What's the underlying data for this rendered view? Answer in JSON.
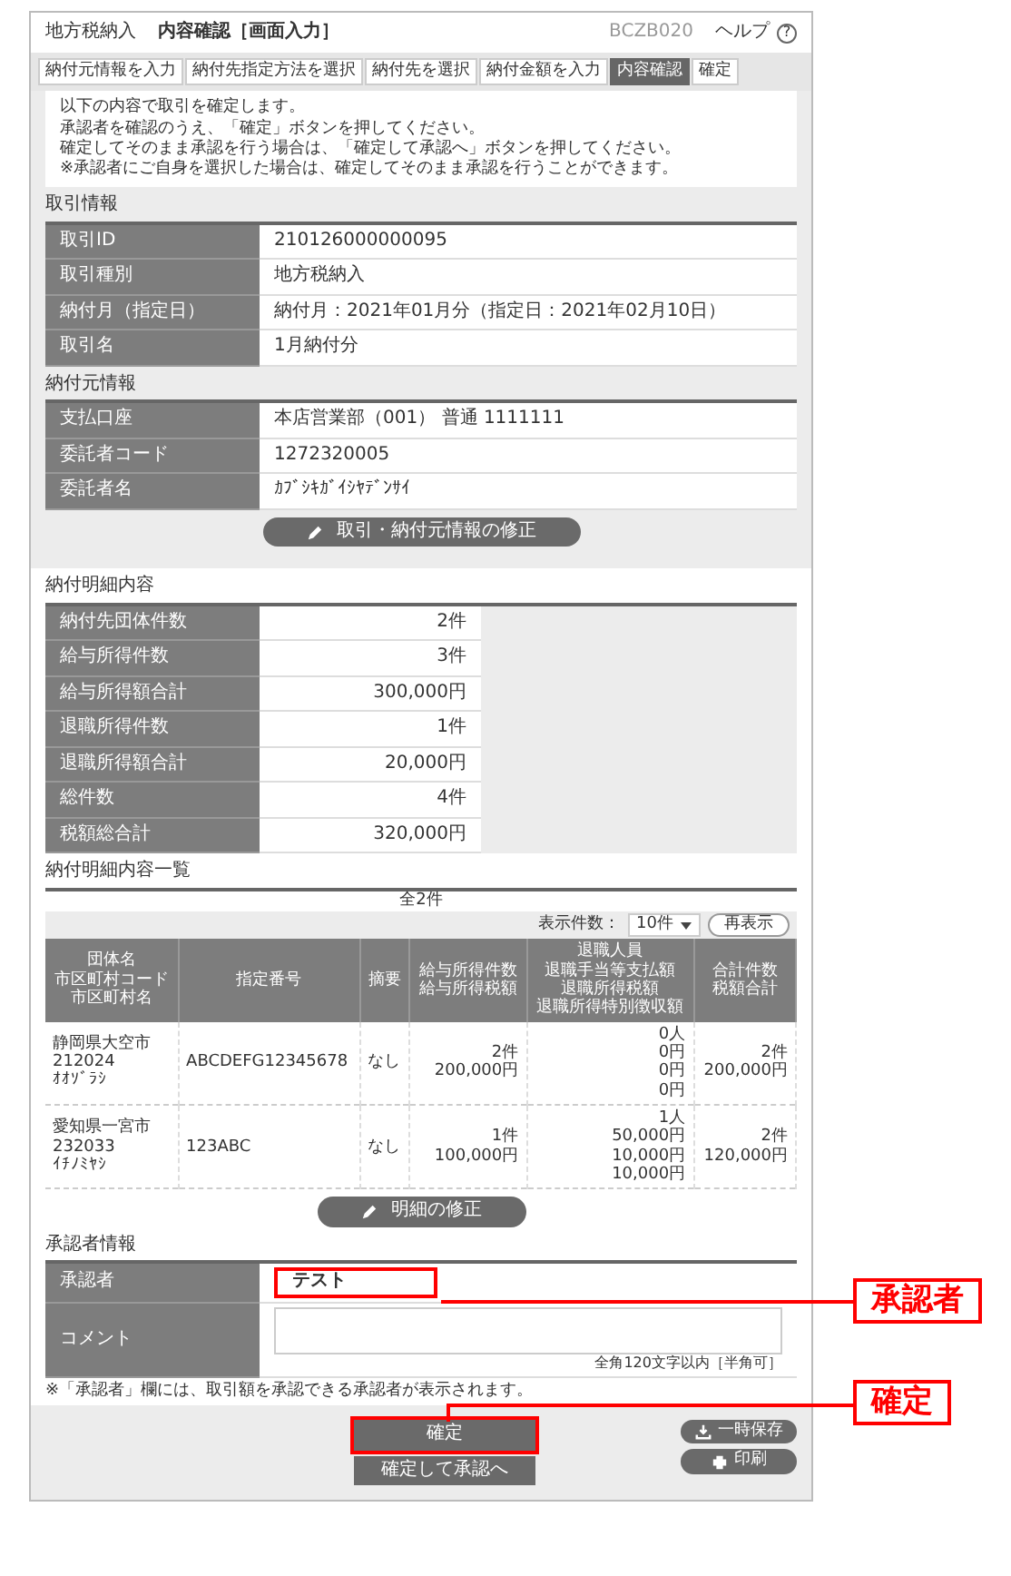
{
  "header": {
    "section": "地方税納入",
    "title": "内容確認［画面入力］",
    "screen_id": "BCZB020",
    "help": "ヘルプ",
    "help_icon": "?"
  },
  "steps": [
    {
      "label": "納付元情報を入力",
      "selected": false
    },
    {
      "label": "納付先指定方法を選択",
      "selected": false
    },
    {
      "label": "納付先を選択",
      "selected": false
    },
    {
      "label": "納付金額を入力",
      "selected": false
    },
    {
      "label": "内容確認",
      "selected": true
    },
    {
      "label": "確定",
      "selected": false
    }
  ],
  "message": [
    "以下の内容で取引を確定します。",
    "承認者を確認のうえ、「確定」ボタンを押してください。",
    "確定してそのまま承認を行う場合は、「確定して承認へ」ボタンを押してください。",
    "※承認者にご自身を選択した場合は、確定してそのまま承認を行うことができます。"
  ],
  "transaction_info": {
    "title": "取引情報",
    "rows": [
      {
        "label": "取引ID",
        "value": "210126000000095"
      },
      {
        "label": "取引種別",
        "value": "地方税納入"
      },
      {
        "label": "納付月（指定日）",
        "value": "納付月：2021年01月分（指定日：2021年02月10日）"
      },
      {
        "label": "取引名",
        "value": "1月納付分"
      }
    ]
  },
  "payer_info": {
    "title": "納付元情報",
    "rows": [
      {
        "label": "支払口座",
        "value": "本店営業部（001） 普通 1111111"
      },
      {
        "label": "委託者コード",
        "value": "1272320005"
      },
      {
        "label": "委託者名",
        "value": "ｶﾌﾞｼｷｶﾞｲｼﾔﾃﾞﾝｻｲ"
      }
    ],
    "edit_button": "取引・納付元情報の修正"
  },
  "summary": {
    "title": "納付明細内容",
    "rows": [
      {
        "label": "納付先団体件数",
        "value": "2件"
      },
      {
        "label": "給与所得件数",
        "value": "3件"
      },
      {
        "label": "給与所得額合計",
        "value": "300,000円"
      },
      {
        "label": "退職所得件数",
        "value": "1件"
      },
      {
        "label": "退職所得額合計",
        "value": "20,000円"
      },
      {
        "label": "総件数",
        "value": "4件"
      },
      {
        "label": "税額総合計",
        "value": "320,000円"
      }
    ]
  },
  "detail_list": {
    "title": "納付明細内容一覧",
    "total": "全2件",
    "per_page_label": "表示件数：",
    "per_page": "10件",
    "refresh": "再表示",
    "columns": [
      {
        "lines": [
          "団体名",
          "市区町村コード",
          "市区町村名"
        ]
      },
      {
        "lines": [
          "指定番号"
        ]
      },
      {
        "lines": [
          "摘要"
        ]
      },
      {
        "lines": [
          "給与所得件数",
          "給与所得税額"
        ]
      },
      {
        "lines": [
          "退職人員",
          "退職手当等支払額",
          "退職所得税額",
          "退職所得特別徴収額"
        ]
      },
      {
        "lines": [
          "合計件数",
          "税額合計"
        ]
      }
    ],
    "rows": [
      [
        {
          "lines": [
            "静岡県大空市",
            "212024",
            "ｵｵｿﾞﾗｼ"
          ]
        },
        {
          "lines": [
            "ABCDEFG12345678"
          ]
        },
        {
          "lines": [
            "なし"
          ]
        },
        {
          "lines": [
            "2件",
            "200,000円"
          ]
        },
        {
          "lines": [
            "0人",
            "0円",
            "0円",
            "0円"
          ]
        },
        {
          "lines": [
            "2件",
            "200,000円"
          ]
        }
      ],
      [
        {
          "lines": [
            "愛知県一宮市",
            "232033",
            "ｲﾁﾉﾐﾔｼ"
          ]
        },
        {
          "lines": [
            "123ABC"
          ]
        },
        {
          "lines": [
            "なし"
          ]
        },
        {
          "lines": [
            "1件",
            "100,000円"
          ]
        },
        {
          "lines": [
            "1人",
            "50,000円",
            "10,000円",
            "10,000円"
          ]
        },
        {
          "lines": [
            "2件",
            "120,000円"
          ]
        }
      ]
    ],
    "edit_button": "明細の修正"
  },
  "approver_info": {
    "title": "承認者情報",
    "approver_label": "承認者",
    "approver": "テスト",
    "approver_highlighted": true,
    "comment_label": "コメント",
    "comment_hint": "全角120文字以内［半角可］",
    "note": "※「承認者」欄には、取引額を承認できる承認者が表示されます。"
  },
  "actions": [
    {
      "label": "確定",
      "kind": "primary",
      "highlighted": true
    },
    {
      "label": "確定して承認へ",
      "kind": "primary",
      "highlighted": false
    },
    {
      "label": "一時保存",
      "kind": "save",
      "highlighted": false
    },
    {
      "label": "印刷",
      "kind": "print",
      "highlighted": false
    }
  ],
  "annotations": [
    {
      "label": "承認者"
    },
    {
      "label": "確定"
    }
  ]
}
